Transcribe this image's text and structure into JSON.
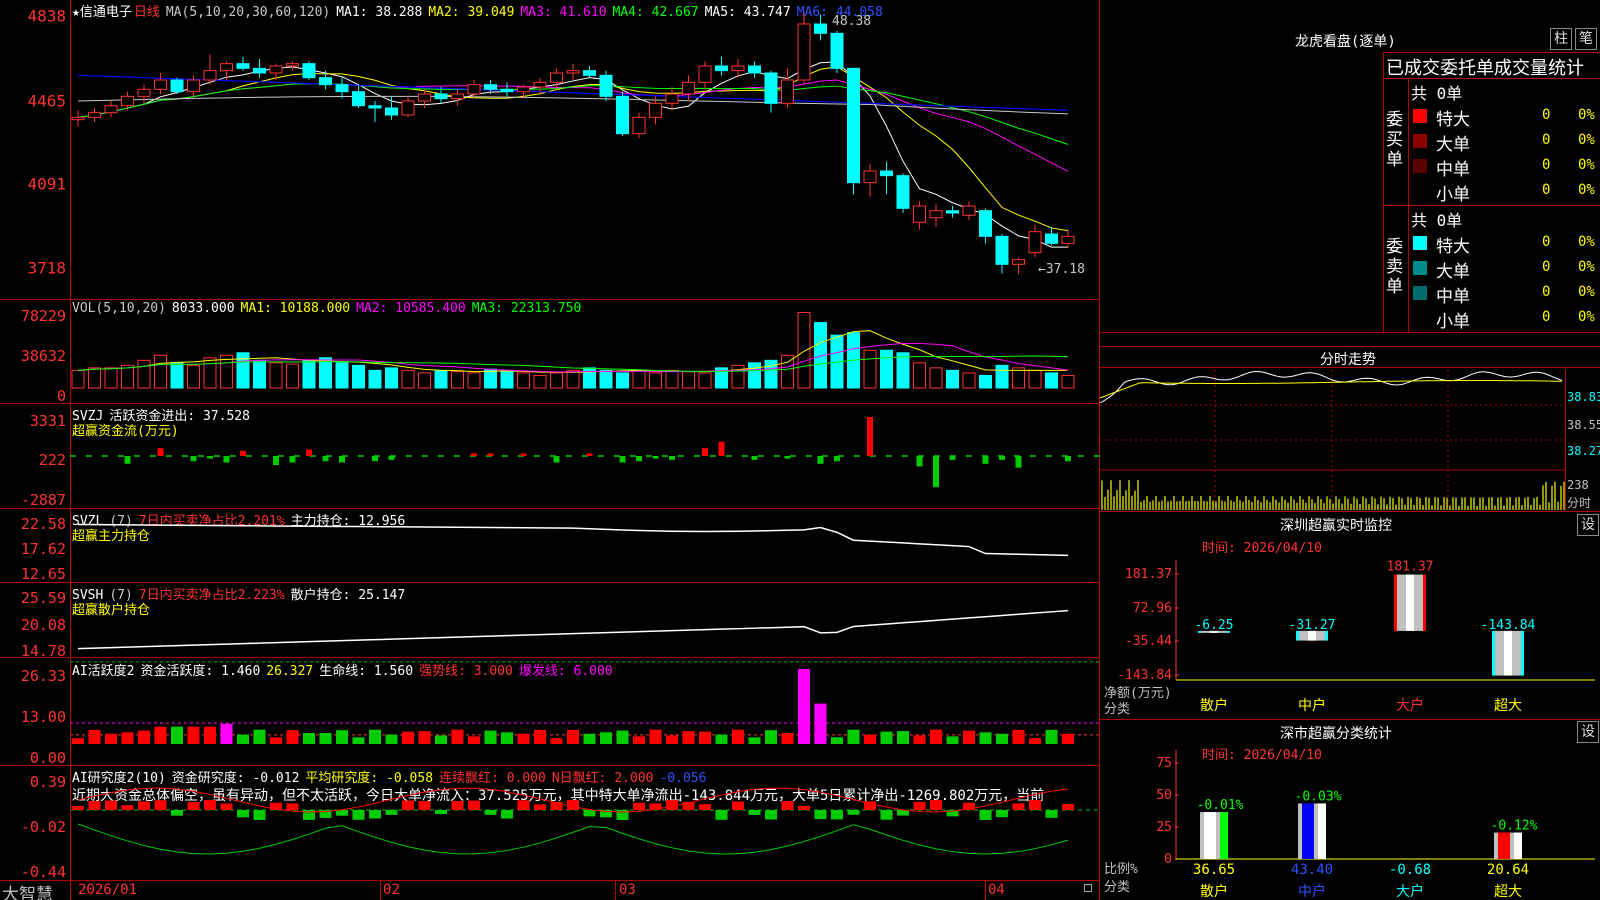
{
  "app": {
    "brand": "大智慧"
  },
  "stock": {
    "star": "★",
    "name": "信通电子",
    "period": "日线"
  },
  "colors": {
    "up": "#ff3232",
    "down": "#00ffff",
    "ma1": "#ffffff",
    "ma2": "#ffff00",
    "ma3": "#ff00ff",
    "ma4": "#00ff00",
    "ma5": "#ffffff",
    "ma6": "#0000ff",
    "axis": "#ff3232",
    "grid": "#b00000"
  },
  "price": {
    "header": {
      "ma_params": "MA(5,10,20,30,60,120)",
      "ma1": "MA1: 38.288",
      "ma2": "MA2: 39.049",
      "ma3": "MA3: 41.610",
      "ma4": "MA4: 42.667",
      "ma5": "MA5: 43.747",
      "ma6": "MA6: 44.058"
    },
    "yticks": [
      "4838",
      "4465",
      "4091",
      "3718"
    ],
    "ylim": [
      36.5,
      48.5
    ],
    "high_label": "48.38",
    "low_label": "←37.18",
    "candles": [
      [
        43.8,
        44.2,
        43.5,
        43.9
      ],
      [
        43.9,
        44.3,
        43.7,
        44.1
      ],
      [
        44.1,
        44.6,
        43.9,
        44.4
      ],
      [
        44.4,
        45.0,
        44.2,
        44.8
      ],
      [
        44.8,
        45.3,
        44.5,
        45.1
      ],
      [
        45.1,
        45.8,
        44.9,
        45.5
      ],
      [
        45.5,
        45.6,
        44.9,
        45.0
      ],
      [
        45.0,
        45.7,
        44.8,
        45.5
      ],
      [
        45.5,
        46.6,
        45.3,
        45.9
      ],
      [
        45.9,
        46.3,
        45.5,
        46.2
      ],
      [
        46.2,
        46.5,
        45.9,
        46.0
      ],
      [
        46.0,
        46.4,
        45.6,
        45.8
      ],
      [
        45.8,
        46.2,
        45.5,
        46.1
      ],
      [
        46.1,
        46.3,
        45.9,
        46.2
      ],
      [
        46.2,
        46.3,
        45.5,
        45.6
      ],
      [
        45.6,
        45.9,
        45.1,
        45.3
      ],
      [
        45.3,
        45.6,
        44.7,
        45.0
      ],
      [
        45.0,
        45.3,
        44.3,
        44.4
      ],
      [
        44.4,
        44.6,
        43.7,
        44.3
      ],
      [
        44.3,
        44.8,
        43.8,
        44.0
      ],
      [
        44.0,
        44.8,
        43.9,
        44.6
      ],
      [
        44.6,
        45.1,
        44.3,
        44.9
      ],
      [
        44.9,
        45.2,
        44.5,
        44.7
      ],
      [
        44.7,
        45.1,
        44.4,
        44.9
      ],
      [
        44.9,
        45.5,
        44.7,
        45.3
      ],
      [
        45.3,
        45.5,
        44.9,
        45.1
      ],
      [
        45.1,
        45.4,
        44.8,
        45.0
      ],
      [
        45.0,
        45.3,
        44.7,
        45.2
      ],
      [
        45.2,
        45.6,
        44.9,
        45.4
      ],
      [
        45.4,
        46.0,
        45.1,
        45.8
      ],
      [
        45.8,
        46.2,
        45.5,
        45.9
      ],
      [
        45.9,
        46.1,
        45.6,
        45.7
      ],
      [
        45.7,
        45.9,
        44.6,
        44.8
      ],
      [
        44.8,
        45.0,
        43.1,
        43.2
      ],
      [
        43.2,
        44.1,
        43.0,
        43.9
      ],
      [
        43.9,
        44.8,
        43.6,
        44.5
      ],
      [
        44.5,
        45.2,
        44.2,
        44.9
      ],
      [
        44.9,
        45.7,
        44.6,
        45.4
      ],
      [
        45.4,
        46.3,
        45.1,
        46.1
      ],
      [
        46.1,
        46.5,
        45.7,
        45.9
      ],
      [
        45.9,
        46.4,
        45.6,
        46.1
      ],
      [
        46.1,
        46.3,
        45.6,
        45.8
      ],
      [
        45.8,
        45.9,
        44.1,
        44.5
      ],
      [
        44.5,
        46.0,
        44.3,
        45.5
      ],
      [
        45.5,
        48.38,
        45.3,
        47.9
      ],
      [
        47.9,
        48.3,
        47.2,
        47.5
      ],
      [
        47.5,
        47.6,
        45.8,
        46.0
      ],
      [
        46.0,
        46.0,
        40.6,
        41.1
      ],
      [
        41.1,
        41.9,
        40.5,
        41.6
      ],
      [
        41.6,
        42.0,
        40.6,
        41.4
      ],
      [
        41.4,
        41.5,
        39.8,
        40.0
      ],
      [
        39.4,
        40.3,
        39.1,
        40.1
      ],
      [
        39.6,
        40.2,
        39.2,
        39.9
      ],
      [
        39.9,
        40.1,
        39.6,
        39.8
      ],
      [
        39.7,
        40.3,
        39.5,
        40.1
      ],
      [
        39.9,
        40.0,
        38.5,
        38.8
      ],
      [
        38.8,
        38.9,
        37.2,
        37.6
      ],
      [
        37.6,
        37.9,
        37.18,
        37.8
      ],
      [
        38.1,
        39.3,
        37.9,
        39.0
      ],
      [
        38.9,
        39.2,
        38.4,
        38.5
      ],
      [
        38.5,
        39.1,
        38.3,
        38.8
      ]
    ],
    "date_labels": [
      "2026/01",
      "02",
      "03",
      "04"
    ]
  },
  "vol": {
    "header": {
      "params": "VOL(5,10,20)",
      "value": "8033.000",
      "ma1": "MA1: 10188.000",
      "ma2": "MA2: 10585.400",
      "ma3": "MA3: 22313.750"
    },
    "yticks": [
      "78229",
      "38632",
      "0"
    ],
    "values": [
      14,
      16,
      16,
      18,
      22,
      26,
      20,
      18,
      24,
      26,
      28,
      22,
      20,
      19,
      22,
      24,
      20,
      18,
      14,
      16,
      14,
      12,
      14,
      13,
      12,
      15,
      14,
      12,
      10,
      12,
      14,
      16,
      14,
      12,
      14,
      12,
      14,
      13,
      12,
      16,
      18,
      20,
      22,
      26,
      60,
      52,
      42,
      44,
      30,
      30,
      28,
      20,
      16,
      14,
      12,
      10,
      18,
      16,
      14,
      12,
      10
    ]
  },
  "svzj": {
    "header": {
      "name": "SVZJ",
      "label": "活跃资金进出: 37.528",
      "sub": "超赢资金流(万元)"
    },
    "yticks": [
      "3331",
      "222",
      "-2887"
    ],
    "values": [
      0,
      0,
      0,
      -600,
      0,
      600,
      0,
      -400,
      -200,
      -500,
      400,
      0,
      -700,
      -500,
      500,
      -400,
      -500,
      0,
      -400,
      -300,
      0,
      0,
      0,
      0,
      200,
      200,
      0,
      200,
      0,
      -500,
      0,
      200,
      0,
      -500,
      -400,
      -200,
      -300,
      0,
      600,
      1100,
      0,
      -300,
      0,
      -200,
      0,
      -600,
      -400,
      0,
      3000,
      0,
      0,
      -800,
      -2400,
      -300,
      0,
      -600,
      -300,
      -900,
      0,
      0,
      -400,
      0,
      -600,
      -300,
      0,
      0,
      0
    ]
  },
  "svzl": {
    "header": {
      "name": "SVZL",
      "params": "(7)",
      "label1": "7日内买卖净占比2.201%",
      "label2": "主力持仓: 12.956",
      "sub": "超赢主力持仓"
    },
    "yticks": [
      "22.58",
      "17.62",
      "12.65"
    ]
  },
  "svsh": {
    "header": {
      "name": "SVSH",
      "params": "(7)",
      "label1": "7日内买卖净占比2.223%",
      "label2": "散户持仓: 25.147",
      "sub": "超赢散户持仓"
    },
    "yticks": [
      "25.59",
      "20.08",
      "14.78"
    ]
  },
  "ai1": {
    "header": {
      "name": "AI活跃度2",
      "label": "资金活跃度: 1.460",
      "v2": "26.327",
      "v3": "生命线: 1.560",
      "v4": "强势线: 3.000",
      "v5": "爆发线: 6.000"
    },
    "yticks": [
      "26.33",
      "13.00",
      "0.00"
    ]
  },
  "ai2": {
    "header": {
      "name": "AI研究度2(10)",
      "label": "资金研究度: -0.012",
      "v2": "平均研究度: -0.058",
      "v3": "连续飘红: 0.000",
      "v4": "N日飘红: 2.000",
      "v5": "-0.056"
    },
    "yticks": [
      "0.39",
      "-0.02",
      "-0.44"
    ],
    "comment": "近期大资金总体偏空，虽有异动，但不太活跃，今日大单净流入：37.525万元，其中特大单净流出-143.844万元，大单5日累计净出-1269.802万元，当前"
  },
  "lhb": {
    "title": "龙虎看盘(逐单)",
    "btn1": "柱",
    "btn2": "笔",
    "subtitle": "已成交委托单成交量统计",
    "buy": {
      "side": "委买单",
      "count": "共 0单",
      "rows": [
        {
          "label": "特大",
          "v": "0",
          "p": "0%",
          "c": "#ff0000"
        },
        {
          "label": "大单",
          "v": "0",
          "p": "0%",
          "c": "#8b0000"
        },
        {
          "label": "中单",
          "v": "0",
          "p": "0%",
          "c": "#5a0000"
        },
        {
          "label": "小单",
          "v": "0",
          "p": "0%",
          "c": "#000000"
        }
      ]
    },
    "sell": {
      "side": "委卖单",
      "count": "共 0单",
      "rows": [
        {
          "label": "特大",
          "v": "0",
          "p": "0%",
          "c": "#00ffff"
        },
        {
          "label": "大单",
          "v": "0",
          "p": "0%",
          "c": "#008b8b"
        },
        {
          "label": "中单",
          "v": "0",
          "p": "0%",
          "c": "#006b6b"
        },
        {
          "label": "小单",
          "v": "0",
          "p": "0%",
          "c": "#000000"
        }
      ]
    }
  },
  "fenshi": {
    "title": "分时走势",
    "yticks": [
      "38.83",
      "38.55",
      "38.27"
    ],
    "vol_tick": "238",
    "vol_label": "分时"
  },
  "sz_monitor": {
    "title": "深圳超赢实时监控",
    "btn": "设",
    "time": "时间: 2026/04/10",
    "yticks": [
      "181.37",
      "72.96",
      "-35.44",
      "-143.84"
    ],
    "ylabel1": "净额(万元)",
    "ylabel2": "分类",
    "bars": [
      {
        "cat": "散户",
        "v": -6.25,
        "lbl": "-6.25"
      },
      {
        "cat": "中户",
        "v": -31.27,
        "lbl": "-31.27"
      },
      {
        "cat": "大户",
        "v": 181.37,
        "lbl": "181.37"
      },
      {
        "cat": "超大",
        "v": -143.84,
        "lbl": "-143.84"
      }
    ]
  },
  "sz_class": {
    "title": "深市超赢分类统计",
    "btn": "设",
    "time": "时间: 2026/04/10",
    "yticks": [
      "75",
      "50",
      "25",
      "0"
    ],
    "ylabel1": "比例%",
    "ylabel2": "分类",
    "bars": [
      {
        "cat": "散户",
        "v": 36.65,
        "lbl": "36.65",
        "top": "-0.01%",
        "col": "#ffffff",
        "col2": "#00ff00"
      },
      {
        "cat": "中户",
        "v": 43.4,
        "lbl": "43.40",
        "top": "-0.03%",
        "col": "#0000ff",
        "col2": "#ffffff"
      },
      {
        "cat": "大户",
        "v": 0,
        "lbl": "-0.68",
        "top": "",
        "col": "#000",
        "col2": "#000"
      },
      {
        "cat": "超大",
        "v": 20.64,
        "lbl": "20.64",
        "top": "-0.12%",
        "col": "#ff0000",
        "col2": "#ffffff"
      }
    ]
  }
}
